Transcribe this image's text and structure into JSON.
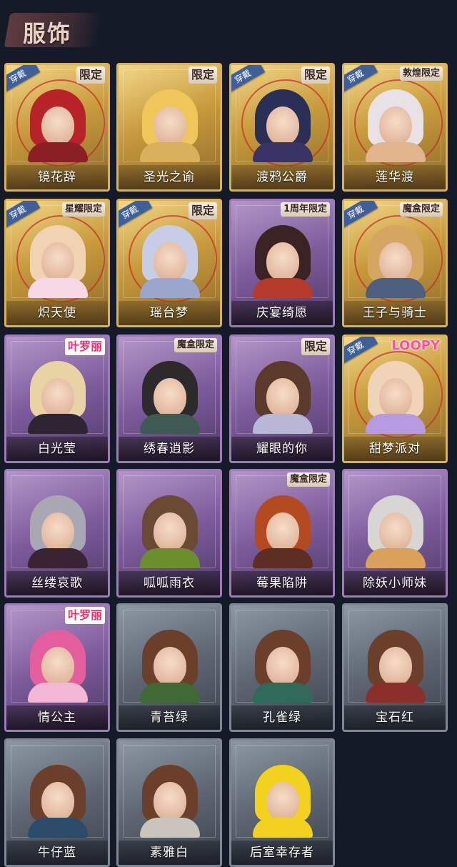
{
  "page": {
    "title": "服饰"
  },
  "costumes": [
    {
      "name": "镜花辞",
      "rarity": "gold",
      "worn": true,
      "tag": "限定",
      "hair": "#b8232a",
      "body": "#8a1f25"
    },
    {
      "name": "圣光之谕",
      "rarity": "gold",
      "worn": false,
      "tag": "限定",
      "hair": "#f0c65a",
      "body": "#d9b15e"
    },
    {
      "name": "渡鸦公爵",
      "rarity": "gold",
      "worn": true,
      "tag": "限定",
      "hair": "#2a2f57",
      "body": "#3a3466"
    },
    {
      "name": "莲华渡",
      "rarity": "gold",
      "worn": true,
      "tag": "敦煌限定",
      "hair": "#e8e2e6",
      "body": "#e0b48c"
    },
    {
      "name": "炽天使",
      "rarity": "gold",
      "worn": true,
      "tag": "星耀限定",
      "hair": "#f1d3b4",
      "body": "#f6d8e6"
    },
    {
      "name": "瑶台梦",
      "rarity": "gold",
      "worn": true,
      "tag": "限定",
      "hair": "#c7cde6",
      "body": "#9aa6cc"
    },
    {
      "name": "庆宴绮愿",
      "rarity": "purple",
      "worn": false,
      "tag": "1周年限定",
      "hair": "#3a2322",
      "body": "#b63a2a"
    },
    {
      "name": "王子与骑士",
      "rarity": "gold",
      "worn": true,
      "tag": "魔盒限定",
      "hair": "#d4a661",
      "body": "#4c5f7e"
    },
    {
      "name": "白光莹",
      "rarity": "purple",
      "worn": false,
      "tag": "叶罗丽",
      "hair": "#e9d3a4",
      "body": "#2f2433"
    },
    {
      "name": "绣春逍影",
      "rarity": "purple",
      "worn": false,
      "tag": "魔盒限定",
      "hair": "#2c2a2a",
      "body": "#3e5a52"
    },
    {
      "name": "耀眼的你",
      "rarity": "purple",
      "worn": false,
      "tag": "限定",
      "hair": "#5b3a2c",
      "body": "#b8b7d5"
    },
    {
      "name": "甜梦派对",
      "rarity": "gold",
      "worn": true,
      "tag": "LOOPY",
      "hair": "#efd4b9",
      "body": "#b79be0"
    },
    {
      "name": "丝缕哀歌",
      "rarity": "purple",
      "worn": false,
      "tag": "",
      "hair": "#a9a7b3",
      "body": "#3a2433"
    },
    {
      "name": "呱呱雨衣",
      "rarity": "purple",
      "worn": false,
      "tag": "",
      "hair": "#6a4a33",
      "body": "#6b8f2c"
    },
    {
      "name": "莓果陷阱",
      "rarity": "purple",
      "worn": false,
      "tag": "魔盒限定",
      "hair": "#b44a20",
      "body": "#5c2f22"
    },
    {
      "name": "除妖小师妹",
      "rarity": "purple",
      "worn": false,
      "tag": "",
      "hair": "#d8d6d2",
      "body": "#d9a15a"
    },
    {
      "name": "情公主",
      "rarity": "purple",
      "worn": false,
      "tag": "叶罗丽",
      "hair": "#e45d9c",
      "body": "#f1b7d4"
    },
    {
      "name": "青苔绿",
      "rarity": "gray",
      "worn": false,
      "tag": "",
      "hair": "#6b3f2a",
      "body": "#3f6a36"
    },
    {
      "name": "孔雀绿",
      "rarity": "gray",
      "worn": false,
      "tag": "",
      "hair": "#6b3f2a",
      "body": "#2f6a5a"
    },
    {
      "name": "宝石红",
      "rarity": "gray",
      "worn": false,
      "tag": "",
      "hair": "#6b3f2a",
      "body": "#8a2f2a"
    },
    {
      "name": "牛仔蓝",
      "rarity": "gray",
      "worn": false,
      "tag": "",
      "hair": "#6b3f2a",
      "body": "#2c4a6a"
    },
    {
      "name": "素雅白",
      "rarity": "gray",
      "worn": false,
      "tag": "",
      "hair": "#6b3f2a",
      "body": "#c9c4bc"
    },
    {
      "name": "后室幸存者",
      "rarity": "gray",
      "worn": false,
      "tag": "",
      "hair": "#f2d21e",
      "body": "#f2d21e"
    }
  ],
  "labels": {
    "worn": "穿戴"
  }
}
